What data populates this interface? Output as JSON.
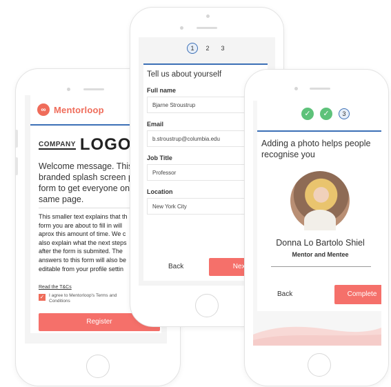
{
  "colors": {
    "accent": "#f5706a",
    "brand_blue": "#3b6fb6",
    "done_green": "#5ec27a"
  },
  "phone1": {
    "brand_icon": "infinity-logo-icon",
    "brand_name": "Mentorloop",
    "logo_company": "COMPANY",
    "logo_text": "LOGO",
    "welcome": "Welcome message. This is\nbranded splash screen pre\nform to get everyone on th\nsame page.",
    "small_text": "This smaller text explains that th\nform you are about to fill in will\naprox this amount of time. We c\nalso explain what the next steps\nafter the form is submited. The\nanswers to this form will also be\neditable from your profile settin",
    "tcs_link": "Read the T&Cs",
    "agree_text": "I agree to Mentorloop's Terms and Conditions",
    "agree_checked": true,
    "register_label": "Register"
  },
  "phone2": {
    "steps": [
      "1",
      "2",
      "3"
    ],
    "active_step": 1,
    "heading": "Tell us about yourself",
    "fields": [
      {
        "label": "Full name",
        "value": "Bjarne Stroustrup"
      },
      {
        "label": "Email",
        "value": "b.stroustrup@columbia.edu"
      },
      {
        "label": "Job Title",
        "value": "Professor"
      },
      {
        "label": "Location",
        "value": "New York City"
      }
    ],
    "back_label": "Back",
    "next_label": "Next"
  },
  "phone3": {
    "steps": [
      {
        "label": "✓",
        "state": "done"
      },
      {
        "label": "✓",
        "state": "done"
      },
      {
        "label": "3",
        "state": "active"
      }
    ],
    "intro": "Adding a photo helps people recognise you",
    "person_name": "Donna Lo Bartolo Shiel",
    "role": "Mentor and Mentee",
    "back_label": "Back",
    "complete_label": "Complete"
  }
}
